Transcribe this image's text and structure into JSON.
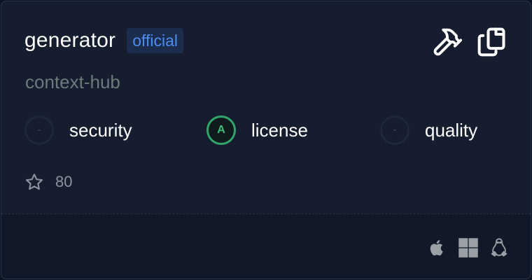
{
  "card": {
    "title": "generator",
    "badge": "official",
    "subtitle": "context-hub",
    "actions": {
      "build_icon": "hammer-icon",
      "copy_icon": "copy-icon"
    }
  },
  "scores": [
    {
      "label": "security",
      "grade": "-",
      "state": "empty"
    },
    {
      "label": "license",
      "grade": "A",
      "state": "pass",
      "color": "#31a56b"
    },
    {
      "label": "quality",
      "grade": "-",
      "state": "empty"
    }
  ],
  "stars": {
    "icon": "star-icon",
    "count": "80"
  },
  "platforms": [
    {
      "icon": "apple-icon"
    },
    {
      "icon": "windows-icon"
    },
    {
      "icon": "linux-icon"
    }
  ],
  "colors": {
    "background": "#151d2f",
    "footer": "#111827",
    "accent_badge": "#4c8df0",
    "grade_a": "#31a56b"
  }
}
